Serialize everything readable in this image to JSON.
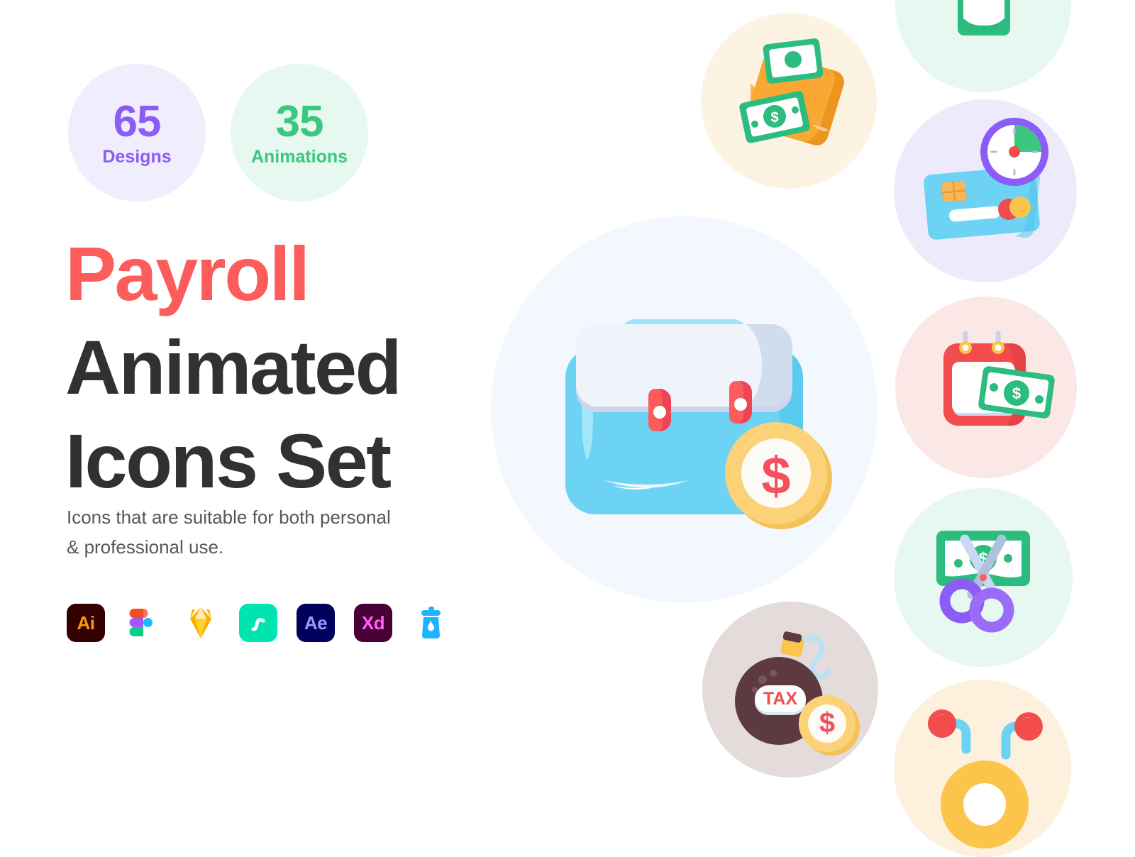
{
  "badges": [
    {
      "number": "65",
      "label": "Designs",
      "color": "#8B5CF6",
      "background": "#F0EDFD",
      "name": "designs-badge"
    },
    {
      "number": "35",
      "label": "Animations",
      "color": "#3BC77F",
      "background": "#E6F8EF",
      "name": "animations-badge"
    }
  ],
  "headline": {
    "line1": "Payroll",
    "line2": "Animated",
    "line3": "Icons Set",
    "accent_color": "#FC5C5C",
    "text_color": "#2F3133"
  },
  "subtitle": {
    "line1": "Icons that are suitable for both personal",
    "line2": "& professional use."
  },
  "app_icons": [
    {
      "name": "adobe-illustrator-icon",
      "label": "Ai",
      "color": "#FF9A00",
      "background": "#330000"
    },
    {
      "name": "figma-icon",
      "label": "",
      "color": "#F24E1E",
      "background": "transparent"
    },
    {
      "name": "sketch-icon",
      "label": "",
      "color": "#FDB300",
      "background": "transparent"
    },
    {
      "name": "principle-icon",
      "label": "",
      "color": "#FFFFFF",
      "background": "#00E5B0"
    },
    {
      "name": "adobe-after-effects-icon",
      "label": "Ae",
      "color": "#9999FF",
      "background": "#00005B"
    },
    {
      "name": "adobe-xd-icon",
      "label": "Xd",
      "color": "#FF61F6",
      "background": "#470137"
    },
    {
      "name": "lottiefiles-icon",
      "label": "",
      "color": "#1EB2FF",
      "background": "transparent"
    }
  ],
  "illustrations": {
    "main": {
      "name": "briefcase-with-dollar-coin",
      "background": "#F2F8FD",
      "coin_symbol": "$"
    },
    "bubbles": [
      {
        "name": "wallet-with-cash-icon",
        "background": "#FDF3E2"
      },
      {
        "name": "salary-increase-icon",
        "background": "#E6F8EF"
      },
      {
        "name": "credit-card-with-clock-icon",
        "background": "#EDEBFB"
      },
      {
        "name": "payday-calendar-icon",
        "background": "#FCE7E7"
      },
      {
        "name": "budget-cut-scissors-icon",
        "background": "#E6F8EF"
      },
      {
        "name": "tax-bomb-icon",
        "background": "#E4DCDB",
        "label": "TAX"
      },
      {
        "name": "payment-distribution-icon",
        "background": "#FDF0DC"
      }
    ]
  },
  "palette": {
    "red": "#FC5C5C",
    "green": "#2DBC7F",
    "blue": "#6DD3F5",
    "orange": "#F9A933",
    "purple": "#8B5CF6",
    "yellow": "#FBD277",
    "dark": "#2F3133"
  }
}
